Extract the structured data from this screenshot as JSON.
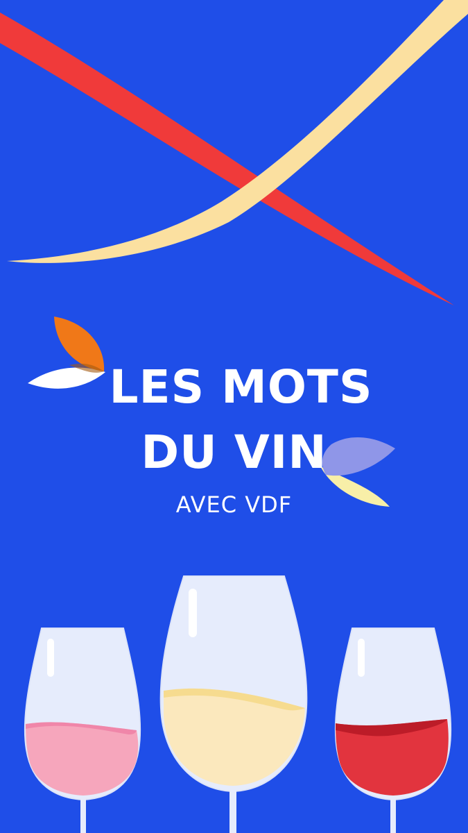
{
  "title_line1": "LES MOTS",
  "title_line2": "DU VIN",
  "subtitle": "AVEC VDF",
  "colors": {
    "background": "#1f4ee8",
    "red_ribbon": "#f03a3a",
    "cream_ribbon": "#fbe0a0",
    "leaf_orange": "#f07818",
    "leaf_white": "#ffffff",
    "leaf_lavender": "#8f96e8",
    "leaf_yellow": "#f8efa8",
    "glass": "#e6ecfc",
    "wine_rose": "#f6a6bc",
    "wine_white": "#fbe8bd",
    "wine_red": "#e2343e"
  },
  "icons": [
    "red-ribbon-icon",
    "cream-ribbon-icon",
    "leaf-icon",
    "wine-glass-icon"
  ]
}
